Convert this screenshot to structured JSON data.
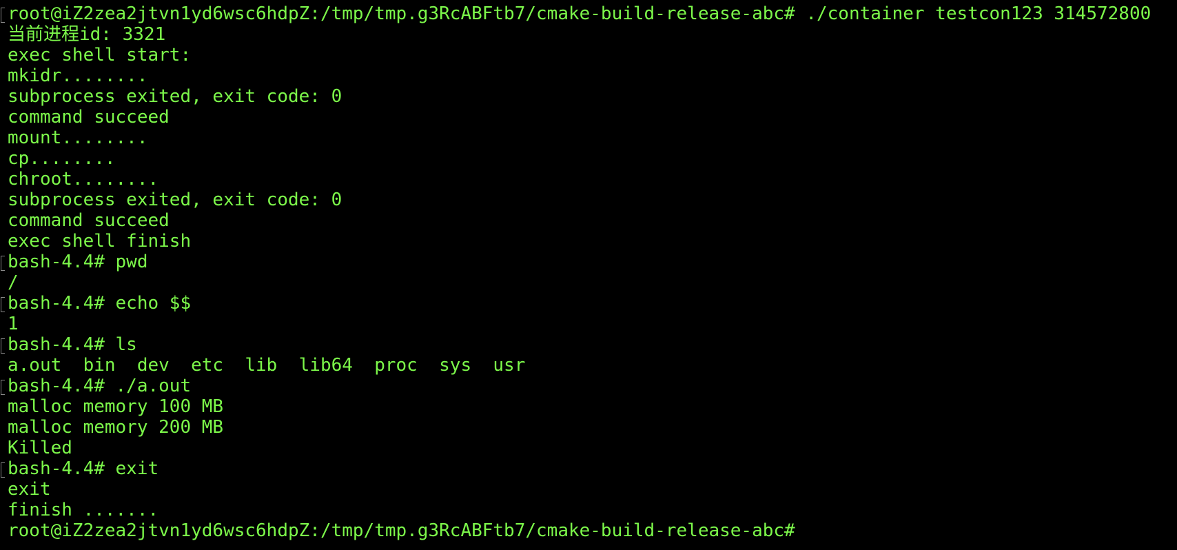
{
  "terminal": {
    "colors": {
      "background": "#000000",
      "foreground": "#7cf74a",
      "line_marker": "#8a8a8a"
    },
    "lines": [
      "root@iZ2zea2jtvn1yd6wsc6hdpZ:/tmp/tmp.g3RcABFtb7/cmake-build-release-abc# ./container testcon123 314572800",
      "当前进程id: 3321",
      "exec shell start:",
      "mkidr........",
      "subprocess exited, exit code: 0",
      "command succeed",
      "mount........",
      "cp........",
      "chroot........",
      "subprocess exited, exit code: 0",
      "command succeed",
      "exec shell finish",
      "bash-4.4# pwd",
      "/",
      "bash-4.4# echo $$",
      "1",
      "bash-4.4# ls",
      "a.out  bin  dev  etc  lib  lib64  proc  sys  usr",
      "bash-4.4# ./a.out",
      "malloc memory 100 MB",
      "malloc memory 200 MB",
      "Killed",
      "bash-4.4# exit",
      "exit",
      "finish .......",
      "root@iZ2zea2jtvn1yd6wsc6hdpZ:/tmp/tmp.g3RcABFtb7/cmake-build-release-abc# "
    ]
  }
}
